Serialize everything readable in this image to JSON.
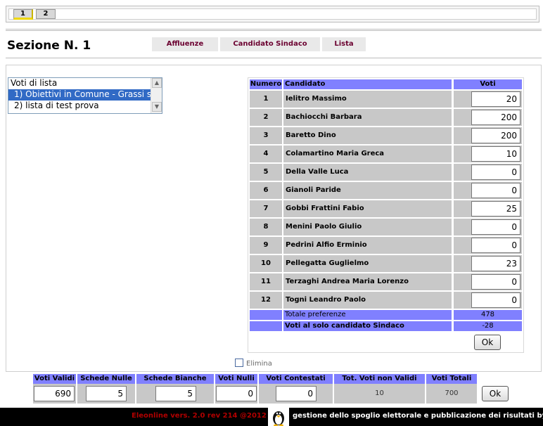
{
  "page_tabs": [
    "1",
    "2"
  ],
  "section_title": "Sezione N. 1",
  "nav_tabs": [
    "Affluenze",
    "Candidato Sindaco",
    "Lista"
  ],
  "list_box": {
    "items": [
      "Voti di lista",
      "1) Obiettivi in Comune - Grassi s",
      "2) lista di test prova"
    ],
    "selected_index": 1
  },
  "candidates_table": {
    "headers": {
      "number": "Numero",
      "candidate": "Candidato",
      "votes": "Voti"
    },
    "rows": [
      {
        "num": "1",
        "name": "Ielitro Massimo",
        "votes": "20"
      },
      {
        "num": "2",
        "name": "Bachiocchi Barbara",
        "votes": "200"
      },
      {
        "num": "3",
        "name": "Baretto Dino",
        "votes": "200"
      },
      {
        "num": "4",
        "name": "Colamartino Maria Greca",
        "votes": "10"
      },
      {
        "num": "5",
        "name": "Della Valle Luca",
        "votes": "0"
      },
      {
        "num": "6",
        "name": "Gianoli Paride",
        "votes": "0"
      },
      {
        "num": "7",
        "name": "Gobbi Frattini Fabio",
        "votes": "25"
      },
      {
        "num": "8",
        "name": "Menini Paolo Giulio",
        "votes": "0"
      },
      {
        "num": "9",
        "name": "Pedrini Alfio Erminio",
        "votes": "0"
      },
      {
        "num": "10",
        "name": "Pellegatta Guglielmo",
        "votes": "23"
      },
      {
        "num": "11",
        "name": "Terzaghi Andrea Maria Lorenzo",
        "votes": "0"
      },
      {
        "num": "12",
        "name": "Togni Leandro Paolo",
        "votes": "0"
      }
    ],
    "totale_label": "Totale preferenze",
    "totale_value": "478",
    "solo_sindaco_label": "Voti al solo candidato Sindaco",
    "solo_sindaco_value": "-28",
    "ok_label": "Ok"
  },
  "elimina_label": "Elimina",
  "totals": {
    "voti_validi": {
      "label": "Voti Validi",
      "value": "690"
    },
    "schede_nulle": {
      "label": "Schede Nulle",
      "value": "5"
    },
    "schede_bianche": {
      "label": "Schede Bianche",
      "value": "5"
    },
    "voti_nulli": {
      "label": "Voti Nulli",
      "value": "0"
    },
    "voti_contestati": {
      "label": "Voti Contestati",
      "value": "0"
    },
    "tot_non_validi": {
      "label": "Tot. Voti non Validi",
      "value": "10"
    },
    "voti_totali": {
      "label": "Voti Totali",
      "value": "700"
    },
    "ok_label": "Ok"
  },
  "footer": {
    "version_text": "Eleonline vers. 2.0 rev 214 @2012",
    "tagline": "gestione dello spoglio elettorale e pubblicazione dei risultati by"
  },
  "colors": {
    "header_blue": "#8080ff",
    "cell_grey": "#c8c8c8",
    "nav_text": "#6b0030",
    "footer_red": "#b00000"
  }
}
